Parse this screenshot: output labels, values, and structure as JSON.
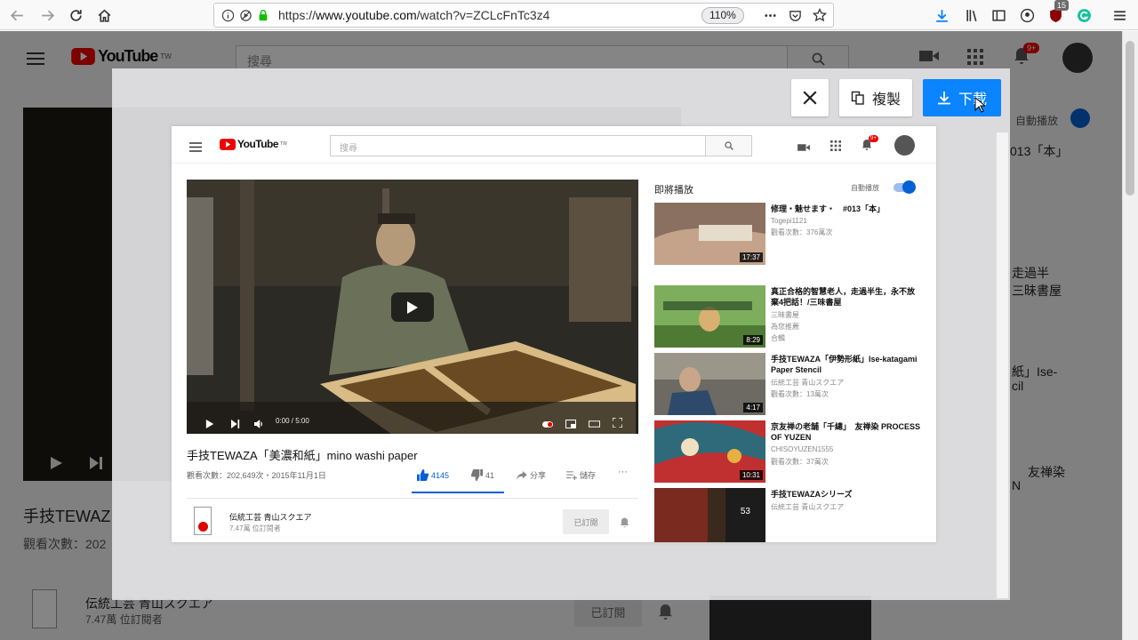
{
  "browser": {
    "url_scheme": "https://",
    "url_domain": "www.youtube.com",
    "url_path": "/watch?v=ZCLcFnTc3z4",
    "zoom": "110%",
    "ext_badge": "15"
  },
  "background": {
    "logo": "YouTube",
    "logo_tm": "TW",
    "search_placeholder": "搜尋",
    "notif_count": "9+",
    "autoplay_label": "自動播放",
    "frag_rec1": "013「本」",
    "frag_rec2a": "走過半",
    "frag_rec2b": "三昧書屋",
    "frag_rec3a": "紙」Ise-",
    "frag_rec3b": "cil",
    "frag_rec4a": "友禅染",
    "frag_rec4b": "N",
    "video_title_fragment": "手技TEWAZ",
    "views_fragment": "觀看次數：202",
    "channel_name": "伝統工芸 青山スクエア",
    "subscribers": "7.47萬 位訂閱者",
    "subscribed_label": "已訂閱"
  },
  "modal": {
    "copy_label": "複製",
    "download_label": "下載"
  },
  "preview": {
    "logo": "YouTube",
    "logo_tm": "TW",
    "search_placeholder": "搜尋",
    "notif_count": "9+",
    "video_time": "0:00 / 5:00",
    "video_title": "手技TEWAZA「美濃和紙」mino washi paper",
    "views_date": "觀看次數：202,649次・2015年11月1日",
    "likes": "4145",
    "dislikes": "41",
    "share_label": "分享",
    "save_label": "儲存",
    "more_label": "···",
    "channel_name": "伝統工芸 青山スクエア",
    "subscribers": "7.47萬 位訂閱者",
    "subscribed_label": "已訂閱",
    "up_next": "即將播放",
    "autoplay": "自動播放",
    "recommendations": [
      {
        "title": "修理・魅せます・　#013「本」",
        "channel": "Togepi1121",
        "views": "觀看次數：376萬次",
        "duration": "17:37"
      },
      {
        "title": "真正合格的智慧老人，走過半生，永不放棄4把話！/三味書屋",
        "channel": "三昧書屋",
        "views": "為您推薦",
        "extra": "合輯",
        "duration": "8:29"
      },
      {
        "title": "手技TEWAZA「伊勢形紙」Ise-katagami Paper Stencil",
        "channel": "伝統工芸 青山スクエア",
        "views": "觀看次數：13萬次",
        "duration": "4:17"
      },
      {
        "title": "京友禅の老舗「千總」　友禅染 PROCESS OF YUZEN",
        "channel": "CHISOYUZEN1555",
        "views": "觀看次數：37萬次",
        "duration": "10:31"
      },
      {
        "title": "手技TEWAZAシリーズ",
        "channel": "伝統工芸 青山スクエア",
        "views": "",
        "duration": "53"
      }
    ]
  }
}
